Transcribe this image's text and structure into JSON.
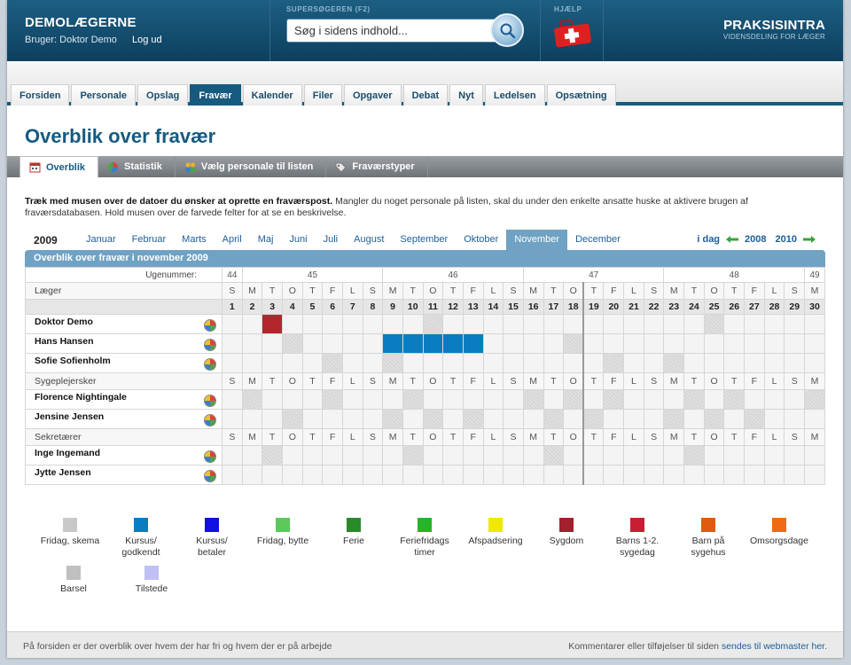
{
  "header": {
    "brand": "DEMOLÆGERNE",
    "user_label": "Bruger: Doktor Demo",
    "logout": "Log ud",
    "search_caption": "SUPERSØGEREN (F2)",
    "search_value": "Søg i sidens indhold...",
    "help_caption": "HJÆLP",
    "logo_name": "PRAKSISINTRA",
    "logo_tagline": "VIDENSDELING FOR LÆGER"
  },
  "nav": {
    "tabs": [
      "Forsiden",
      "Personale",
      "Opslag",
      "Fravær",
      "Kalender",
      "Filer",
      "Opgaver",
      "Debat",
      "Nyt",
      "Ledelsen",
      "Opsætning"
    ],
    "active": "Fravær"
  },
  "page_title": "Overblik over fravær",
  "subtabs": [
    {
      "label": "Overblik",
      "icon": "calendar-icon",
      "active": true
    },
    {
      "label": "Statistik",
      "icon": "pie-chart-icon",
      "active": false
    },
    {
      "label": "Vælg personale til listen",
      "icon": "people-icon",
      "active": false
    },
    {
      "label": "Fraværstyper",
      "icon": "tag-icon",
      "active": false
    }
  ],
  "instructions": {
    "bold": "Træk med musen over de datoer du ønsker at oprette en fraværspost.",
    "rest": " Mangler du noget personale på listen, skal du under den enkelte ansatte huske at aktivere brugen af fraværsdatabasen. Hold musen over de farvede felter for at se en beskrivelse."
  },
  "monthbar": {
    "year": "2009",
    "months": [
      "Januar",
      "Februar",
      "Marts",
      "April",
      "Maj",
      "Juni",
      "Juli",
      "August",
      "September",
      "Oktober",
      "November",
      "December"
    ],
    "active": "November",
    "today": "i dag",
    "prev_year": "2008",
    "next_year": "2010"
  },
  "calendar": {
    "header": "Overblik over fravær i november 2009",
    "week_label": "Ugenummer:",
    "weeks": [
      {
        "num": "44",
        "span": 1
      },
      {
        "num": "45",
        "span": 7
      },
      {
        "num": "46",
        "span": 7
      },
      {
        "num": "47",
        "span": 7
      },
      {
        "num": "48",
        "span": 7
      },
      {
        "num": "49",
        "span": 1
      }
    ],
    "weekdays": [
      "S",
      "M",
      "T",
      "O",
      "T",
      "F",
      "L",
      "S",
      "M",
      "T",
      "O",
      "T",
      "F",
      "L",
      "S",
      "M",
      "T",
      "O",
      "T",
      "F",
      "L",
      "S",
      "M",
      "T",
      "O",
      "T",
      "F",
      "L",
      "S",
      "M"
    ],
    "days": [
      "1",
      "2",
      "3",
      "4",
      "5",
      "6",
      "7",
      "8",
      "9",
      "10",
      "11",
      "12",
      "13",
      "14",
      "15",
      "16",
      "17",
      "18",
      "19",
      "20",
      "21",
      "22",
      "23",
      "24",
      "25",
      "26",
      "27",
      "28",
      "29",
      "30"
    ],
    "today_index": 18,
    "groups": [
      {
        "name": "Læger",
        "people": [
          {
            "name": "Doktor Demo",
            "absences": [
              {
                "day": 3,
                "color": "#b3262e"
              }
            ],
            "sched": [
              11,
              25
            ]
          },
          {
            "name": "Hans Hansen",
            "absences": [
              {
                "day": 9,
                "color": "#0a7dc0"
              },
              {
                "day": 10,
                "color": "#0a7dc0"
              },
              {
                "day": 11,
                "color": "#0a7dc0"
              },
              {
                "day": 12,
                "color": "#0a7dc0"
              },
              {
                "day": 13,
                "color": "#0a7dc0"
              }
            ],
            "sched": [
              4,
              18
            ]
          },
          {
            "name": "Sofie Sofienholm",
            "absences": [],
            "sched": [
              6,
              9,
              20,
              23
            ]
          }
        ]
      },
      {
        "name": "Sygeplejersker",
        "people": [
          {
            "name": "Florence Nightingale",
            "absences": [],
            "sched": [
              2,
              6,
              10,
              16,
              18,
              20,
              24,
              26,
              30
            ]
          },
          {
            "name": "Jensine Jensen",
            "absences": [],
            "sched": [
              4,
              9,
              11,
              13,
              17,
              19,
              23,
              25,
              27
            ]
          }
        ]
      },
      {
        "name": "Sekretærer",
        "people": [
          {
            "name": "Inge Ingemand",
            "absences": [],
            "sched": [
              3,
              10,
              17,
              24
            ]
          },
          {
            "name": "Jytte Jensen",
            "absences": [],
            "sched": []
          }
        ]
      }
    ]
  },
  "legend": [
    {
      "label": "Fridag, skema",
      "color": "#c8c8c8"
    },
    {
      "label": "Kursus/ godkendt",
      "color": "#0a7dc0"
    },
    {
      "label": "Kursus/ betaler",
      "color": "#1010e0"
    },
    {
      "label": "Fridag, bytte",
      "color": "#5cc85c"
    },
    {
      "label": "Ferie",
      "color": "#2a8a2a"
    },
    {
      "label": "Feriefridags timer",
      "color": "#28b428"
    },
    {
      "label": "Afspadsering",
      "color": "#f0e800"
    },
    {
      "label": "Sygdom",
      "color": "#a3202c"
    },
    {
      "label": "Barns 1-2. sygedag",
      "color": "#c81e34"
    },
    {
      "label": "Barn på sygehus",
      "color": "#e05a10"
    },
    {
      "label": "Omsorgsdage",
      "color": "#f06a10"
    },
    {
      "label": "Barsel",
      "color": "#c0c0c0"
    },
    {
      "label": "Tilstede",
      "color": "#c0c0f4"
    }
  ],
  "footer": {
    "left": "På forsiden er der overblik over hvem der har fri og hvem der er på arbejde",
    "right": "Kommentarer eller tilføjelser til siden",
    "link": "sendes til webmaster her."
  }
}
